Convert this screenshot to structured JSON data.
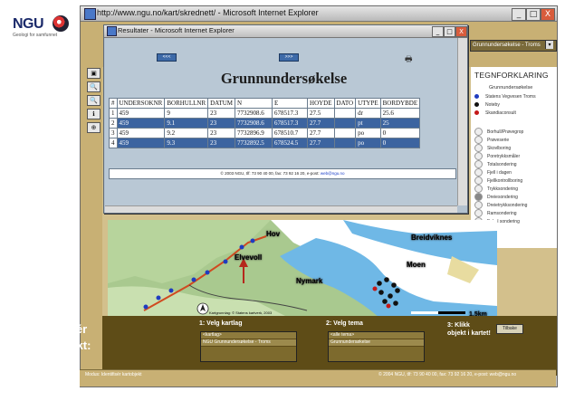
{
  "logo": {
    "text": "NGU",
    "tagline": "Geologi for samfunnet"
  },
  "browser": {
    "title": "http://www.ngu.no/kart/skrednett/ - Microsoft Internet Explorer",
    "controls": {
      "minimize": "_",
      "maximize": "□",
      "close": "X"
    }
  },
  "app": {
    "tools": [
      "▣",
      "🔍",
      "🔍",
      "ℹ",
      "⊕"
    ],
    "layer_select": "Grunnundersøkelse - Troms",
    "legend": {
      "title": "TEGNFORKLARING",
      "subtitle": "Grunnundersøkelse",
      "dots": [
        {
          "label": "Statens Vegvesen Troms",
          "color": "#1f3cc0"
        },
        {
          "label": "Noteby",
          "color": "#111111"
        },
        {
          "label": "Skandiaconsult",
          "color": "#c41818"
        }
      ],
      "symbols": [
        "Borhull/Prøvegrop",
        "Prøveserie",
        "Skovlboring",
        "Poretrykksmåler",
        "Totalsondering",
        "Fjell i dagen",
        "Fjellkontrollboring",
        "Trykksondering",
        "Dreiesondering",
        "Dreietrykksondering",
        "Ramsondering",
        "Enkel sondering"
      ]
    },
    "map": {
      "labels": [
        "Hov",
        "Elvevoll",
        "Nymark",
        "Breidviknes",
        "Moen"
      ],
      "scale": "1.5km",
      "copyright": "Kartgrunnlag: © Statens kartverk, 2003"
    },
    "bottom": {
      "identify_line1": "Identifisér",
      "identify_line2": "kartobjekt:",
      "step1": "1: Velg kartlag",
      "step1_options": [
        "<kartlag>",
        "NGU Grunnundersøkelse - Troms"
      ],
      "step2": "2: Velg tema",
      "step2_options": [
        "<alle tema>",
        "Grunnundersøkelse"
      ],
      "step3_line1": "3: Klikk",
      "step3_line2": "objekt i kartet!",
      "back_button": "Tilbake"
    },
    "status": {
      "left": "Modus: Identifisér kartobjekt",
      "right": "© 2004 NGU, tlf: 73 90 40 00, fax: 73 92 16 20, e-post: web@ngu.no"
    }
  },
  "popup": {
    "title": "Resultater - Microsoft Internet Explorer",
    "nav_prev": "<<<",
    "nav_next": ">>>",
    "print_icon": "🖶",
    "heading": "Grunnundersøkelse",
    "columns": [
      "#",
      "UNDERSOKNR",
      "BORHULLNR",
      "DATUM",
      "N",
      "E",
      "HOYDE",
      "DATO",
      "UTYPE",
      "BORDYBDE"
    ],
    "rows": [
      [
        "1",
        "459",
        "9",
        "23",
        "7732908.6",
        "678517.3",
        "27.5",
        "",
        "dr",
        "25.6"
      ],
      [
        "2",
        "459",
        "9.1",
        "23",
        "7732908.6",
        "678517.3",
        "27.7",
        "",
        "pt",
        "25"
      ],
      [
        "3",
        "459",
        "9.2",
        "23",
        "7732896.9",
        "678510.7",
        "27.7",
        "",
        "po",
        "0"
      ],
      [
        "4",
        "459",
        "9.3",
        "23",
        "7732892.5",
        "678524.5",
        "27.7",
        "",
        "po",
        "0"
      ]
    ],
    "footer_text": "© 2003 NGU, tlf: 73 90 40 00, fax: 73 92 16 20, e-post: ",
    "footer_link": "web@ngu.no"
  }
}
